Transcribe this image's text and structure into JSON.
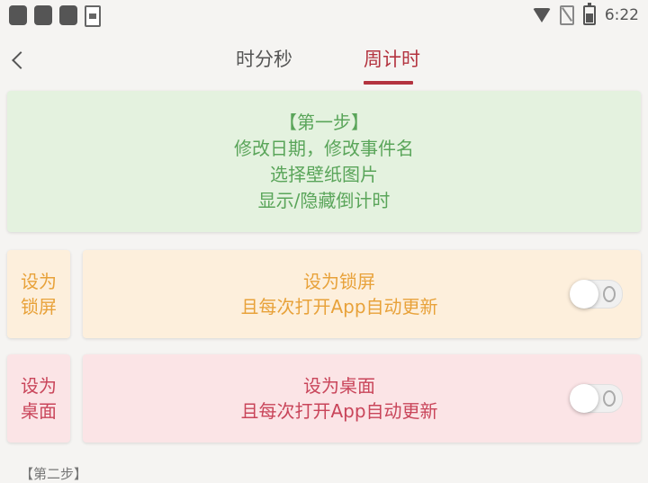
{
  "statusbar": {
    "time": "6:22"
  },
  "tabs": [
    {
      "label": "时分秒",
      "active": false
    },
    {
      "label": "周计时",
      "active": true
    }
  ],
  "accent_color": "#b3333f",
  "step_card": {
    "line1": "【第一步】",
    "line2": "修改日期，修改事件名",
    "line3": "选择壁纸图片",
    "line4": "显示/隐藏倒计时"
  },
  "lock_screen": {
    "side_line1": "设为",
    "side_line2": "锁屏",
    "title": "设为锁屏",
    "subtitle": "且每次打开App自动更新",
    "toggle_on": false
  },
  "desktop": {
    "side_line1": "设为",
    "side_line2": "桌面",
    "title": "设为桌面",
    "subtitle": "且每次打开App自动更新",
    "toggle_on": false
  },
  "bottom": {
    "partial_text": "【第二步】"
  }
}
